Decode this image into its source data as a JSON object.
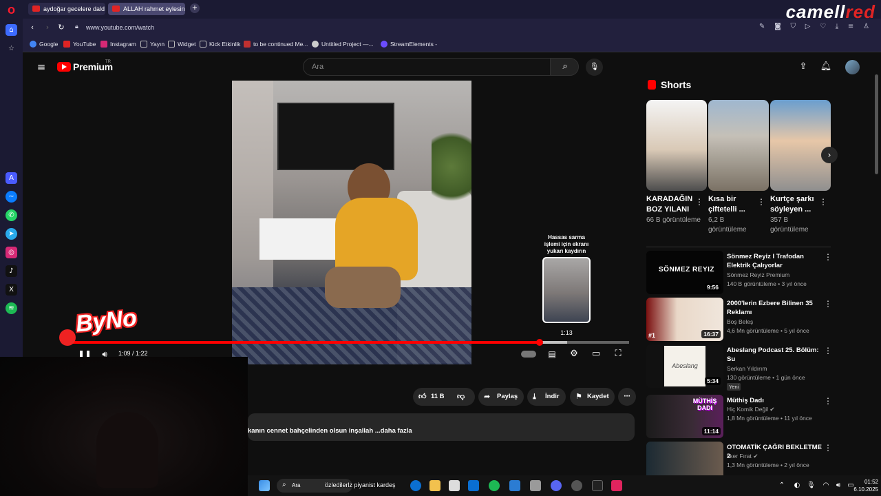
{
  "browser": {
    "tabs": [
      {
        "title": "aydoğar gecelere daldım"
      },
      {
        "title": "ALLAH rahmet eylesin"
      }
    ],
    "new_tab_icon": "plus-icon",
    "brand_text": {
      "main": "camell",
      "accent": "red"
    },
    "url": "www.youtube.com/watch",
    "bookmarks": [
      {
        "label": "Google",
        "color": "#4285f4"
      },
      {
        "label": "YouTube",
        "color": "#e02424"
      },
      {
        "label": "Instagram",
        "color": "#d62976"
      },
      {
        "label": "Yayın",
        "color": "#888888"
      },
      {
        "label": "Widget",
        "color": "#888888"
      },
      {
        "label": "Kick Etkinlik",
        "color": "#888888"
      },
      {
        "label": "to be continued Me...",
        "color": "#c03030"
      },
      {
        "label": "Untitled Project —...",
        "color": "#cccccc"
      },
      {
        "label": "StreamElements -",
        "color": "#6b4cff"
      }
    ]
  },
  "youtube": {
    "logo_text": "Premium",
    "logo_country": "TR",
    "search_placeholder": "Ara",
    "player": {
      "progress_fraction": 0.84,
      "hover_fraction": 0.89,
      "current_time": "1:09",
      "duration": "1:22",
      "preview_time": "1:13",
      "preview_tip": "Hassas sarma işlemi için ekranı yukarı kaydırın"
    },
    "actions": {
      "likes": "11 B",
      "share": "Paylaş",
      "download": "İndir",
      "save": "Kaydet"
    },
    "description_snippet": "kanın cennet bahçelinden olsun inşallah ...daha fazla",
    "shorts_header": "Shorts",
    "shorts": [
      {
        "title": "KARADAĞIN BOZ YILANI",
        "views": "66 B görüntüleme"
      },
      {
        "title": "Kısa bir çiftetelli ...",
        "views": "6,2 B görüntüleme"
      },
      {
        "title": "Kurtçe şarkı söyleyen ...",
        "views": "357 B görüntüleme"
      }
    ],
    "recommendations": [
      {
        "title": "Sönmez Reyiz I Trafodan Elektrik Çalıyorlar",
        "channel": "Sönmez Reyiz Premium",
        "meta": "140 B görüntüleme • 3 yıl önce",
        "duration": "9:56",
        "thumb_text": "SÖNMEZ REYIZ",
        "badge": ""
      },
      {
        "title": "2000'lerin Ezbere Bilinen 35 Reklamı",
        "channel": "Boş Beleş",
        "meta": "4,6 Mn görüntüleme • 5 yıl önce",
        "duration": "16:37",
        "thumb_text": "#1",
        "badge": ""
      },
      {
        "title": "Abeslang Podcast 25. Bölüm: Su",
        "channel": "Serkan Yıldırım",
        "meta": "130 görüntüleme • 1 gün önce",
        "duration": "5:34",
        "thumb_text": "Abeslang",
        "badge": "Yeni"
      },
      {
        "title": "Müthiş Dadı",
        "channel": "Hiç Komik Değil",
        "meta": "1,8 Mn görüntüleme • 11 yıl önce",
        "duration": "11:14",
        "thumb_text": "MÜTHİŞ DADI",
        "badge": ""
      },
      {
        "title": "OTOMATİK ÇAĞRI BEKLETME 2",
        "channel": "İlker Fırat",
        "meta": "1,3 Mn görüntüleme • 2 yıl önce",
        "duration": "",
        "thumb_text": "",
        "badge": ""
      }
    ]
  },
  "overlay": {
    "byno_text": "ByNo",
    "search_label": "Ara",
    "marquee": "özledilerlz piyanist kardeş"
  },
  "taskbar": {
    "time": "01:52",
    "date": "6.10.2025"
  },
  "colors": {
    "youtube_red": "#ff0000",
    "opera_bar": "#1b1a33",
    "yt_bg": "#0f0f0f"
  }
}
